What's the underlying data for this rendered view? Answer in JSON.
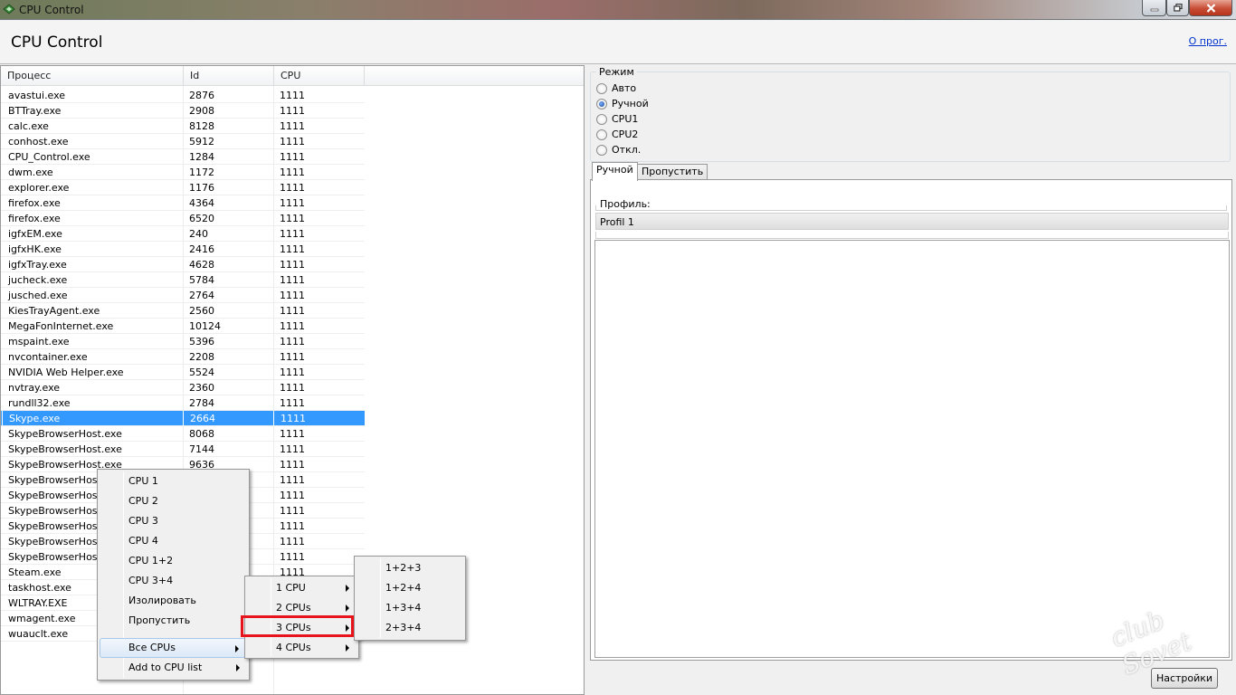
{
  "window": {
    "title": "CPU Control"
  },
  "header": {
    "title": "CPU Control",
    "about_link": "О прог."
  },
  "process_list": {
    "columns": [
      "Процесс",
      "Id",
      "CPU"
    ],
    "rows": [
      [
        "avastui.exe",
        "2876",
        "1111"
      ],
      [
        "BTTray.exe",
        "2908",
        "1111"
      ],
      [
        "calc.exe",
        "8128",
        "1111"
      ],
      [
        "conhost.exe",
        "5912",
        "1111"
      ],
      [
        "CPU_Control.exe",
        "1284",
        "1111"
      ],
      [
        "dwm.exe",
        "1172",
        "1111"
      ],
      [
        "explorer.exe",
        "1176",
        "1111"
      ],
      [
        "firefox.exe",
        "4364",
        "1111"
      ],
      [
        "firefox.exe",
        "6520",
        "1111"
      ],
      [
        "igfxEM.exe",
        "240",
        "1111"
      ],
      [
        "igfxHK.exe",
        "2416",
        "1111"
      ],
      [
        "igfxTray.exe",
        "4628",
        "1111"
      ],
      [
        "jucheck.exe",
        "5784",
        "1111"
      ],
      [
        "jusched.exe",
        "2764",
        "1111"
      ],
      [
        "KiesTrayAgent.exe",
        "2560",
        "1111"
      ],
      [
        "MegaFonInternet.exe",
        "10124",
        "1111"
      ],
      [
        "mspaint.exe",
        "5396",
        "1111"
      ],
      [
        "nvcontainer.exe",
        "2208",
        "1111"
      ],
      [
        "NVIDIA Web Helper.exe",
        "5524",
        "1111"
      ],
      [
        "nvtray.exe",
        "2360",
        "1111"
      ],
      [
        "rundll32.exe",
        "2784",
        "1111"
      ],
      [
        "Skype.exe",
        "2664",
        "1111"
      ],
      [
        "SkypeBrowserHost.exe",
        "8068",
        "1111"
      ],
      [
        "SkypeBrowserHost.exe",
        "7144",
        "1111"
      ],
      [
        "SkypeBrowserHost.exe",
        "9636",
        "1111"
      ],
      [
        "SkypeBrowserHost.e",
        "",
        "1111"
      ],
      [
        "SkypeBrowserHost.e",
        "",
        "1111"
      ],
      [
        "SkypeBrowserHost.e",
        "",
        "1111"
      ],
      [
        "SkypeBrowserHost.e",
        "",
        "1111"
      ],
      [
        "SkypeBrowserHost.e",
        "",
        "1111"
      ],
      [
        "SkypeBrowserHost.e",
        "",
        "1111"
      ],
      [
        "Steam.exe",
        "",
        "1111"
      ],
      [
        "taskhost.exe",
        "",
        ""
      ],
      [
        "WLTRAY.EXE",
        "",
        ""
      ],
      [
        "wmagent.exe",
        "",
        ""
      ],
      [
        "wuauclt.exe",
        "",
        ""
      ]
    ],
    "selected_index": 21
  },
  "mode": {
    "label": "Режим",
    "options": [
      "Авто",
      "Ручной",
      "CPU1",
      "CPU2",
      "Откл."
    ],
    "selected": "Ручной"
  },
  "tabs": [
    "Ручной",
    "Пропустить"
  ],
  "active_tab": "Ручной",
  "profile": {
    "label": "Профиль:",
    "items": [
      "Profil 1"
    ]
  },
  "settings_button": "Настройки",
  "context_menu": {
    "items": [
      "CPU 1",
      "CPU 2",
      "CPU 3",
      "CPU 4",
      "CPU 1+2",
      "CPU 3+4",
      "Изолировать",
      "Пропустить",
      "Все CPUs",
      "Add to CPU list"
    ],
    "highlighted": "Все CPUs"
  },
  "submenu_all_cpus": {
    "items": [
      "1 CPU",
      "2 CPUs",
      "3 CPUs",
      "4 CPUs"
    ],
    "highlighted": "3 CPUs"
  },
  "submenu_3_cpus": {
    "items": [
      "1+2+3",
      "1+2+4",
      "1+3+4",
      "2+3+4"
    ]
  },
  "watermark": {
    "text": "club Sovet"
  },
  "colors": {
    "selection": "#3399ff",
    "callout": "#e8141c",
    "link": "#0033cc"
  }
}
